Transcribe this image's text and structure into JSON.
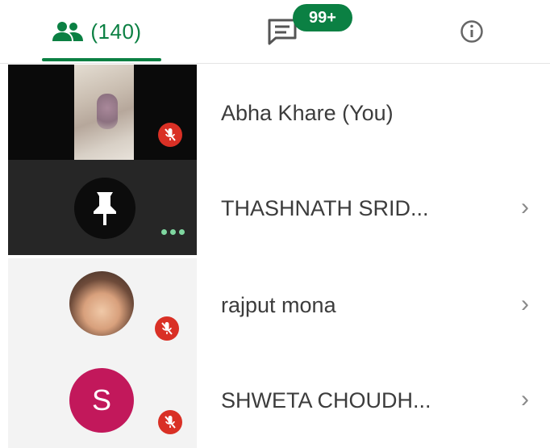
{
  "tabs": {
    "people": {
      "count_label": "(140)"
    },
    "chat": {
      "badge": "99+"
    }
  },
  "participants": [
    {
      "name": "Abha Khare (You)",
      "tile": "video",
      "muted": true,
      "has_chevron": false
    },
    {
      "name": "THASHNATH SRID...",
      "tile": "pinned",
      "muted": false,
      "has_chevron": true
    },
    {
      "name": "rajput mona",
      "tile": "photo-avatar",
      "muted": true,
      "has_chevron": true
    },
    {
      "name": "SHWETA CHOUDH...",
      "tile": "letter-avatar",
      "avatar_letter": "S",
      "avatar_color": "#c2185b",
      "muted": true,
      "has_chevron": true
    }
  ],
  "chevron": "›",
  "colors": {
    "accent": "#0b8043",
    "mute": "#d93025"
  }
}
